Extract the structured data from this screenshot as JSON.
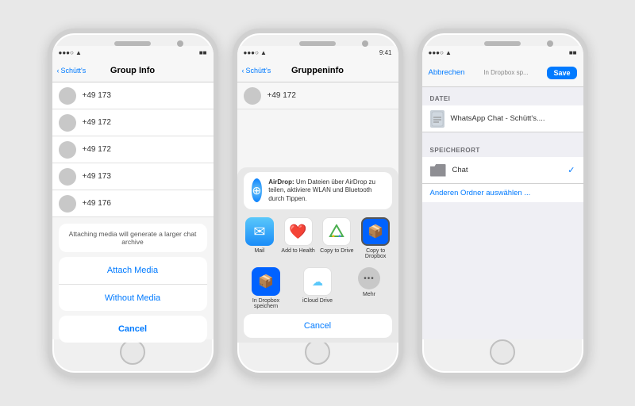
{
  "phone1": {
    "status": {
      "carrier": "●●●○ ▲",
      "wifi": "WiFi",
      "battery": "■■"
    },
    "nav": {
      "back": "Schütt's",
      "title": "Group Info"
    },
    "contacts": [
      {
        "name": "+49 173"
      },
      {
        "name": "+49 172"
      },
      {
        "name": "+49 172"
      },
      {
        "name": "+49 173"
      },
      {
        "name": "+49 176"
      }
    ],
    "dialog": {
      "message": "Attaching media will generate a larger chat archive",
      "attach_btn": "Attach Media",
      "without_btn": "Without Media",
      "cancel_btn": "Cancel"
    }
  },
  "phone2": {
    "status": {
      "carrier": "●●●○ ▲",
      "time": "9:41"
    },
    "nav": {
      "back": "Schütt's",
      "title": "Gruppeninfo"
    },
    "contact": "+49 172",
    "airdrop": {
      "title": "AirDrop:",
      "desc": "Um Dateien über AirDrop zu teilen, aktiviere WLAN und Bluetooth durch Tippen."
    },
    "apps": [
      {
        "label": "Mail",
        "type": "mail"
      },
      {
        "label": "Add to Health",
        "type": "health"
      },
      {
        "label": "Copy to Drive",
        "type": "drive"
      },
      {
        "label": "Copy to Dropbox",
        "type": "dropbox-selected"
      }
    ],
    "apps2": [
      {
        "label": "In Dropbox speichern",
        "type": "dropbox-normal"
      },
      {
        "label": "iCloud Drive",
        "type": "icloud"
      },
      {
        "label": "Mehr",
        "type": "dots"
      }
    ],
    "cancel_btn": "Cancel"
  },
  "phone3": {
    "status": {
      "carrier": "●●●○ ▲"
    },
    "nav": {
      "cancel": "Abbrechen",
      "title_label": "In Dropbox sp...",
      "save_btn": "Save"
    },
    "datei": {
      "section": "DATEI",
      "filename": "WhatsApp Chat - Schütt's...."
    },
    "speicherort": {
      "section": "SPEICHERORT",
      "location": "Chat",
      "other": "Anderen Ordner auswählen ..."
    }
  }
}
